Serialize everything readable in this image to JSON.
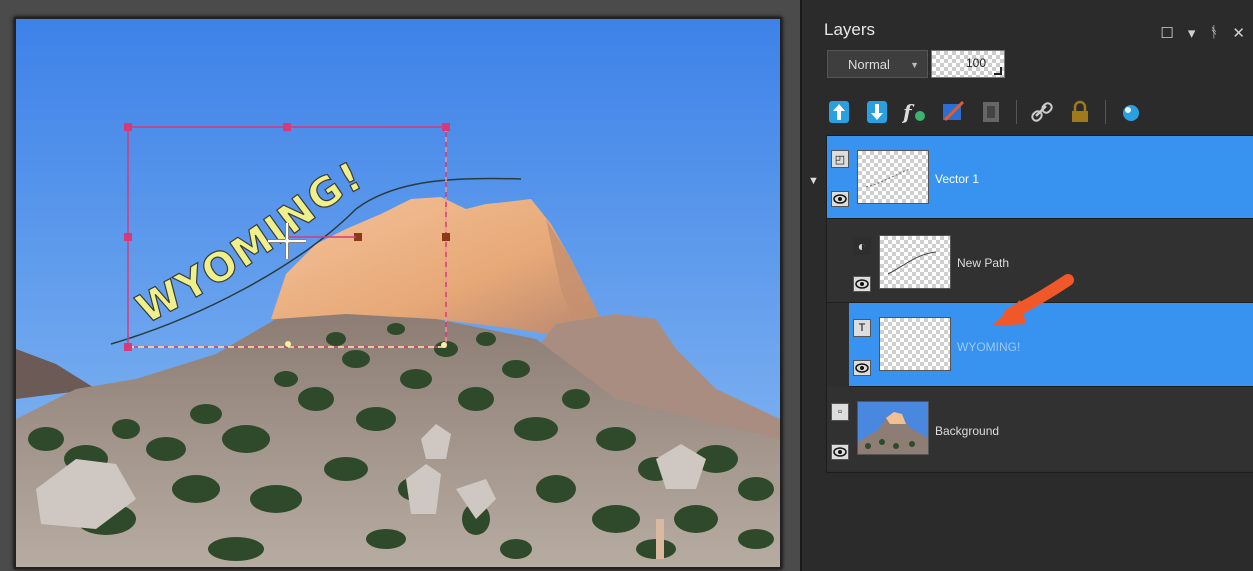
{
  "canvas": {
    "text_on_path": "WYOMING!"
  },
  "panel": {
    "title": "Layers",
    "controls": {
      "restore": "☐",
      "menu": "▾",
      "pin": "ᚬ",
      "close": "✕"
    },
    "blend_mode": "Normal",
    "opacity": "100"
  },
  "toolbar": {
    "buttons": [
      "new-raster-layer",
      "new-vector-layer",
      "layer-styles",
      "edit-selection",
      "mask",
      "link",
      "lock",
      "visibility-toggle"
    ]
  },
  "layers": [
    {
      "name": "Vector 1",
      "type": "vector",
      "selected": true
    },
    {
      "name": "New Path",
      "type": "path",
      "selected": false
    },
    {
      "name": "WYOMING!",
      "type": "text",
      "selected": true
    },
    {
      "name": "Background",
      "type": "raster",
      "selected": false
    }
  ],
  "colors": {
    "selection": "#3793ef",
    "handles": "#d63a7a",
    "arrow": "#f0582a",
    "text_fill": "#f0f08a"
  }
}
